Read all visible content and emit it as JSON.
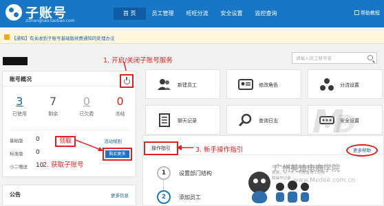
{
  "brand": {
    "name": "子账号",
    "domain": "zizhanghao.taobao.com"
  },
  "nav": {
    "items": [
      {
        "label": "首 页",
        "active": true
      },
      {
        "label": "员工管理",
        "active": false
      },
      {
        "label": "旺旺分流",
        "active": false
      },
      {
        "label": "安全设置",
        "active": false
      },
      {
        "label": "监控查询",
        "active": false
      }
    ],
    "help_label": "帮助教程"
  },
  "notice_bar": {
    "text": "【通知】有关收到子账号基础版续费通知的处理办法"
  },
  "search": {
    "placeholder": "请输入员工账号名"
  },
  "account_overview": {
    "title": "账号概况",
    "stats": [
      {
        "value": "3",
        "label": "已使用"
      },
      {
        "value": "7",
        "label": "剩余"
      },
      {
        "value": "0",
        "label": "已欠费"
      },
      {
        "value": "0",
        "label": "冻结"
      }
    ],
    "plans": [
      {
        "name": "基础版",
        "value": "0"
      },
      {
        "name": "标准版",
        "value": "0"
      },
      {
        "name": "小二赠送",
        "value": "10"
      }
    ],
    "activity_rules_link": "活动规则",
    "buy_more_button": "购买更多"
  },
  "announcements": {
    "title": "公告",
    "more_link": "更多信息"
  },
  "tiles": [
    {
      "label": "新建员工",
      "icon": "users-add-icon"
    },
    {
      "label": "修改角色",
      "icon": "role-card-icon"
    },
    {
      "label": "分流设置",
      "icon": "flow-share-icon"
    },
    {
      "label": "聊天记录",
      "icon": "chat-log-icon"
    },
    {
      "label": "查询日志",
      "icon": "search-log-icon"
    },
    {
      "label": "安全设置",
      "icon": "security-dots-icon"
    }
  ],
  "guide": {
    "title": "操作指引",
    "more_help": "更多帮助",
    "steps": [
      {
        "number": "1",
        "label": "设置部门结构"
      },
      {
        "number": "2",
        "label": "添加员工"
      }
    ],
    "bubble_text": "可以一秒配置子账号并手动添加权限，另一人一号配置员工权限和操作记录"
  },
  "annotations": {
    "a1": "1. 开启/关闭子账号服务",
    "a2": "领取",
    "a3": "2. 获取子账号",
    "a4": "3. 新手操作指引"
  },
  "watermark": {
    "line1": "广州美迪电商学院",
    "line2": "www.Medee.com.cn"
  },
  "colors": {
    "header_blue": "#1876c7",
    "annotation_red": "#e02020",
    "link_blue": "#1a5fa8"
  }
}
